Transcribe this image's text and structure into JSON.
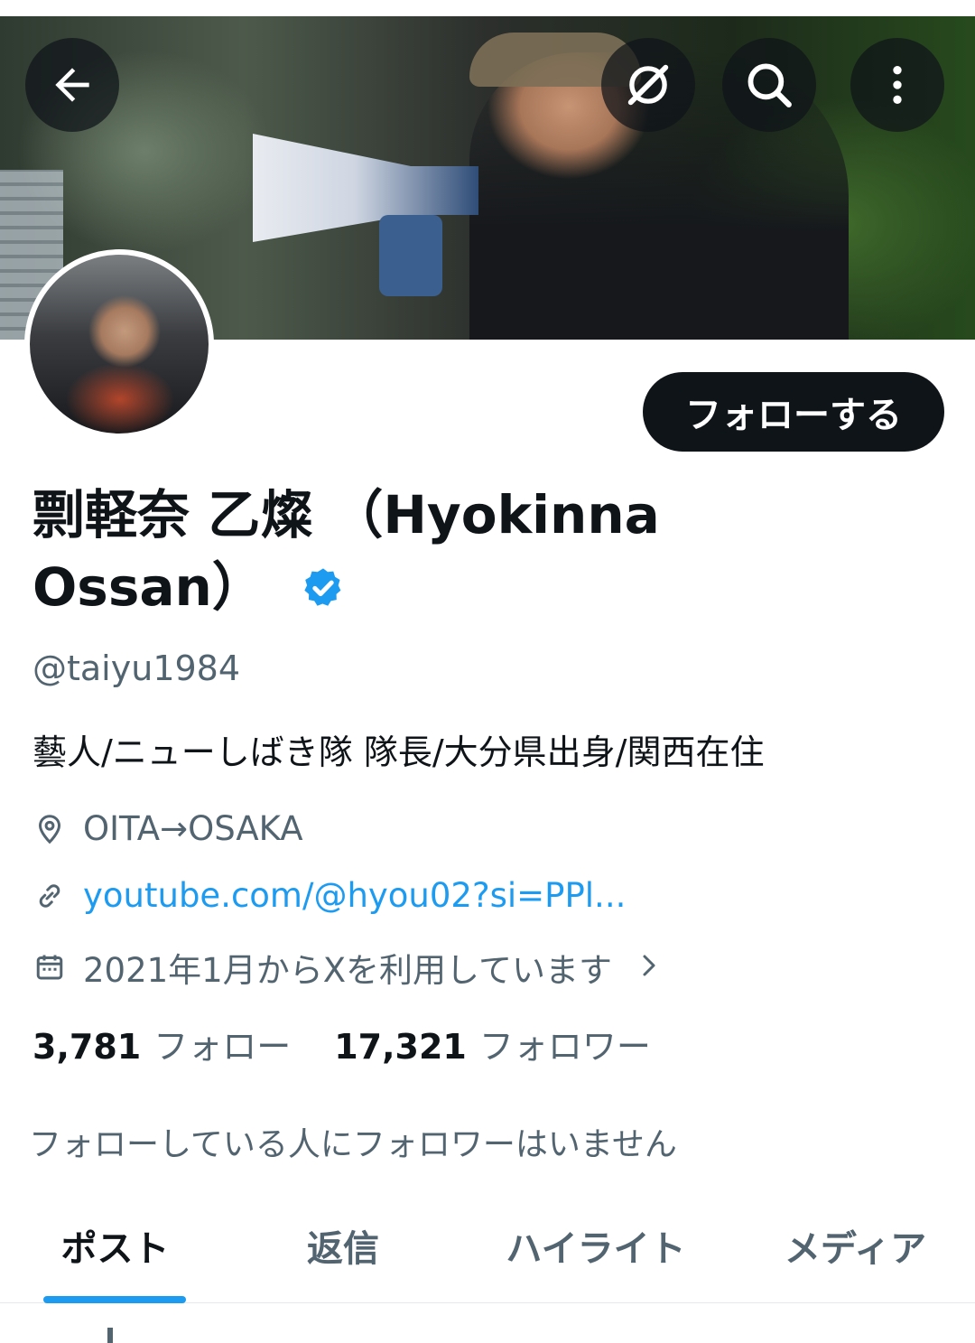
{
  "header": {
    "back_icon": "arrow-left-icon",
    "grok_icon": "grok-icon",
    "search_icon": "search-icon",
    "more_icon": "more-vertical-icon"
  },
  "profile": {
    "follow_button": "フォローする",
    "display_name": "剽軽奈 乙燦 （Hyokinna Ossan）",
    "verified": true,
    "handle": "@taiyu1984",
    "bio": "藝人/ニューしばき隊 隊長/大分県出身/関西在住",
    "location": "OITA→OSAKA",
    "website": "youtube.com/@hyou02?si=PPl...",
    "joined": "2021年1月からXを利用しています",
    "following_count": "3,781",
    "following_label": "フォロー",
    "followers_count": "17,321",
    "followers_label": "フォロワー",
    "mutual_text": "フォローしている人にフォロワーはいません"
  },
  "tabs": [
    {
      "label": "ポスト",
      "active": true
    },
    {
      "label": "返信",
      "active": false
    },
    {
      "label": "ハイライト",
      "active": false
    },
    {
      "label": "メディア",
      "active": false
    }
  ],
  "colors": {
    "accent": "#1d9bf0",
    "text": "#0f1419",
    "secondary": "#536471"
  }
}
